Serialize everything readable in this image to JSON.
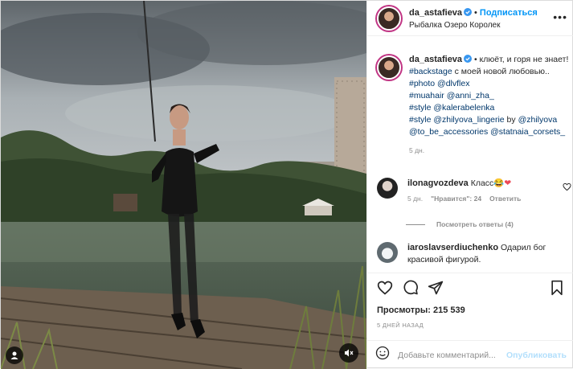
{
  "header": {
    "username": "da_astafieva",
    "separator": "•",
    "follow_label": "Подписаться",
    "location": "Рыбалка Озеро Королек",
    "more_icon": "more-horizontal-icon"
  },
  "caption": {
    "username": "da_astafieva",
    "lead": "• клюёт, и горя не знает!",
    "lines": [
      {
        "tag": "#backstage",
        "text": " с моей новой любовью.."
      },
      {
        "tag": "#photo @dlvflex",
        "text": ""
      },
      {
        "tag": "#muahair @anni_zha_",
        "text": ""
      },
      {
        "tag": "#style @kalerabelenka",
        "text": ""
      },
      {
        "tag": "#style @zhilyova_lingerie",
        "text": " by ",
        "tag2": "@zhilyova"
      },
      {
        "tag": "@to_be_accessories @statnaia_corsets_",
        "text": ""
      }
    ],
    "time": "5 дн."
  },
  "comments": [
    {
      "username": "ilonagvozdeva",
      "text": "Класс",
      "emoji": "😂❤",
      "time": "5 дн.",
      "likes": "\"Нравится\": 24",
      "reply": "Ответить"
    },
    {
      "username": "iaroslavserdiuchenko",
      "text": "Одарил бог красивой фигурой."
    }
  ],
  "view_replies": "Посмотреть ответы (4)",
  "actions": {
    "views_label": "Просмотры: 215 539",
    "posted_ago": "5 ДНЕЙ НАЗАД"
  },
  "add_comment": {
    "placeholder": "Добавьте комментарий...",
    "publish_label": "Опубликовать"
  },
  "colors": {
    "link_blue": "#0095f6",
    "tag_blue": "#00376b",
    "muted": "#8e8e8e",
    "heart_red": "#ed4956"
  }
}
